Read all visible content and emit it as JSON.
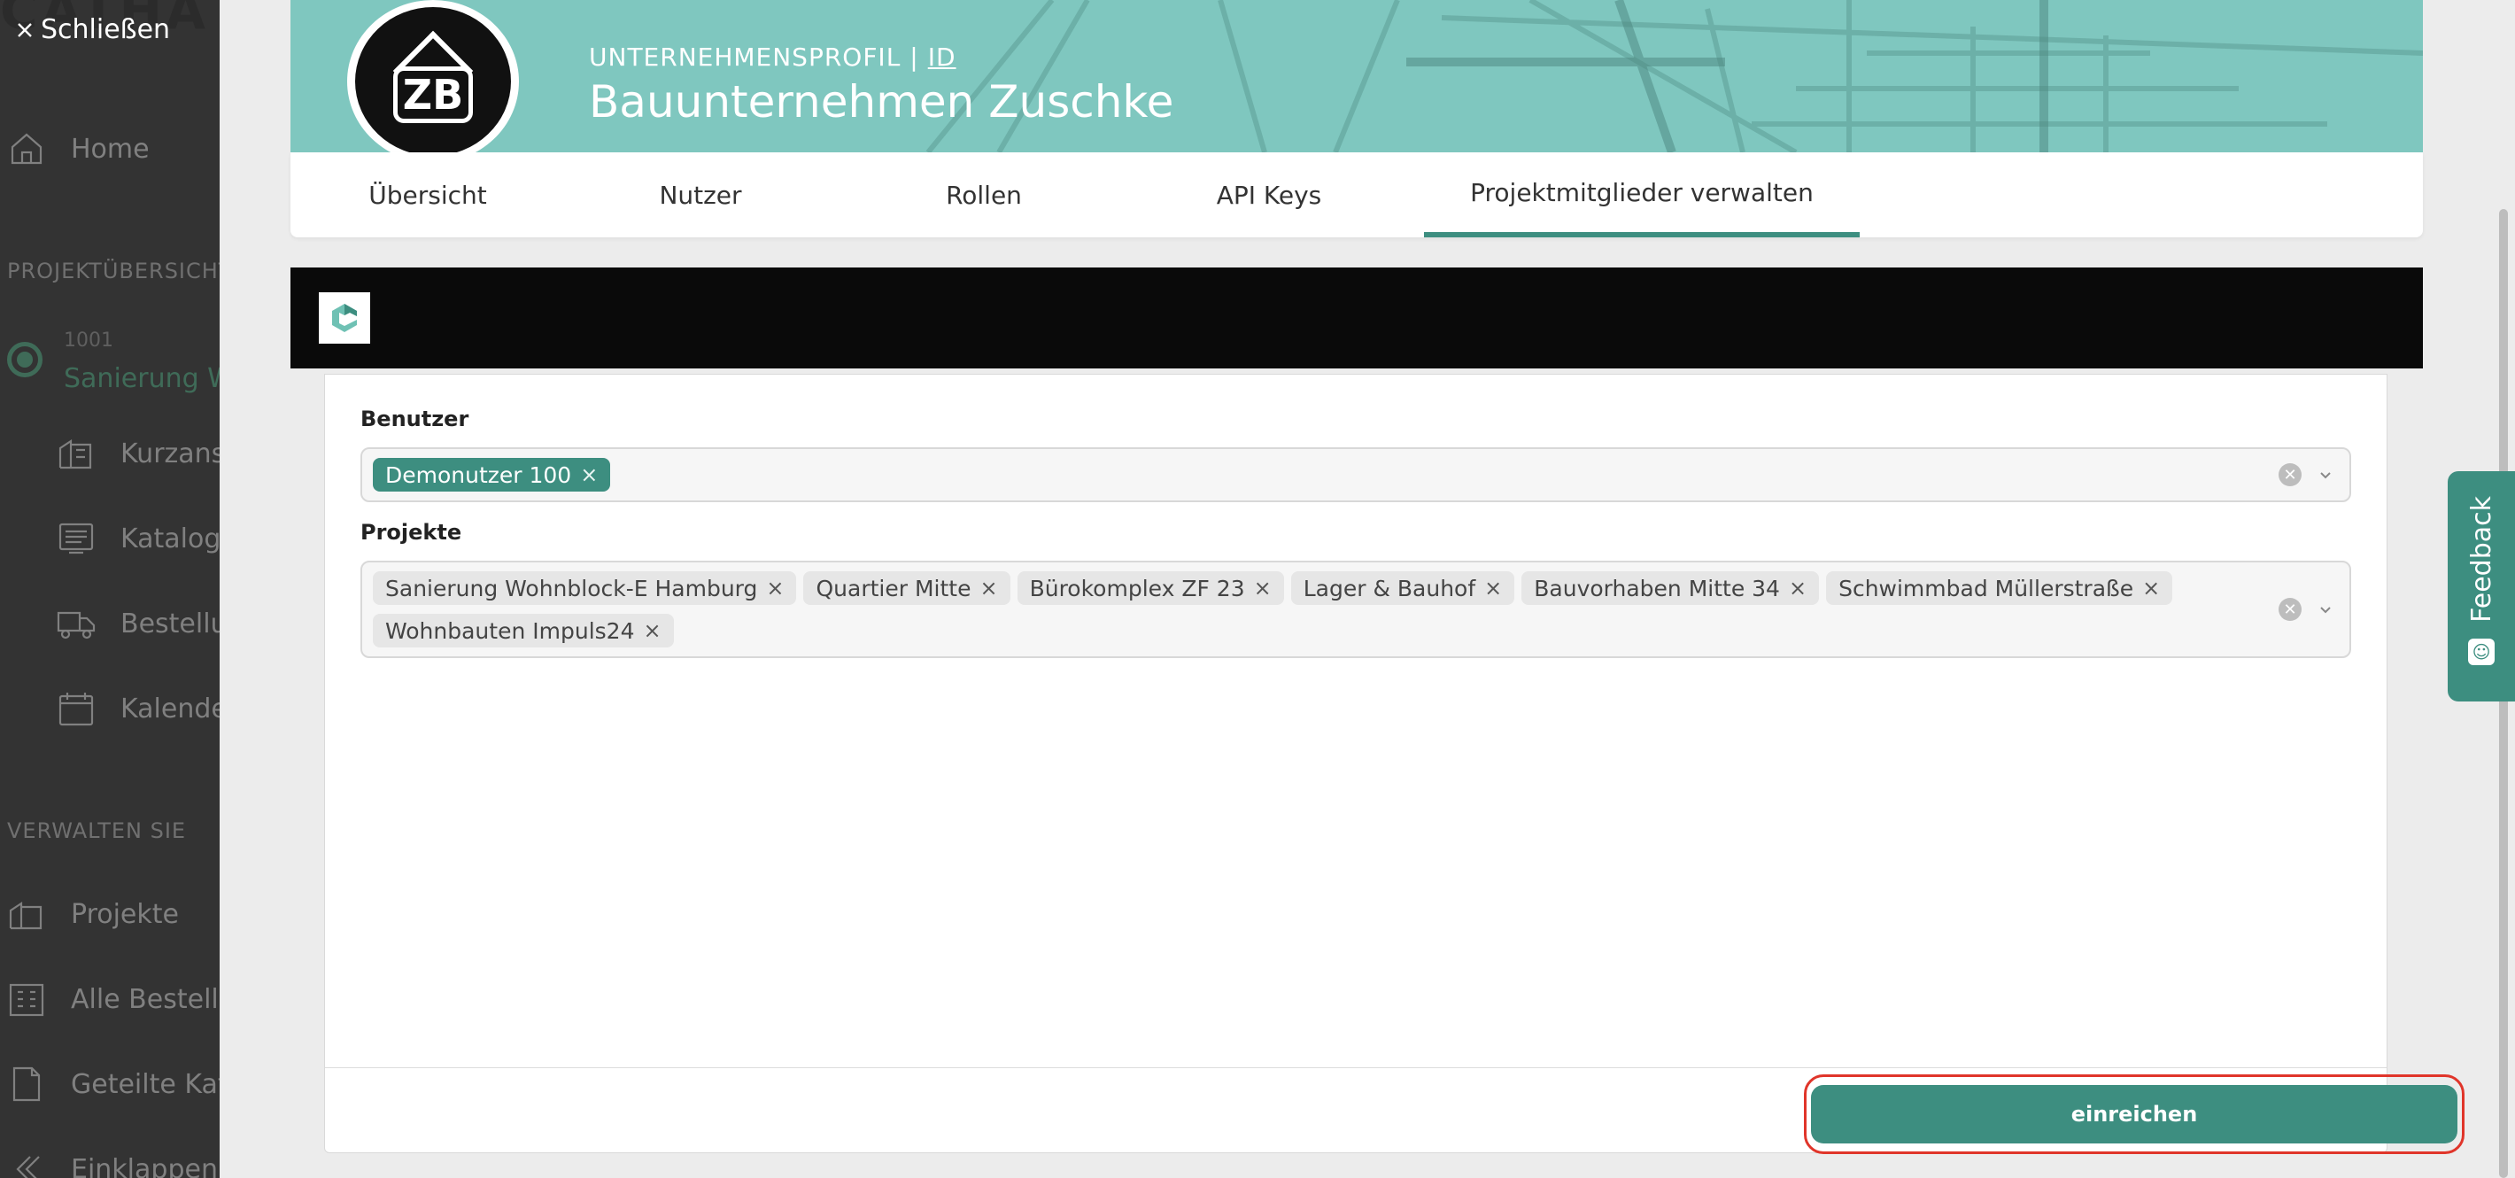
{
  "sidebar": {
    "close_label": "Schließen",
    "logo_fragment": "CATHA",
    "home": "Home",
    "section_projects": "PROJEKTÜBERSICHT",
    "project_number": "1001",
    "project_name": "Sanierung Wohnblock-E Hamburg",
    "items": [
      "Kurzansicht",
      "Katalog",
      "Bestellungen",
      "Kalender"
    ],
    "section_manage": "VERWALTEN SIE",
    "manage_items": [
      "Projekte",
      "Alle Bestellungen",
      "Geteilte Kataloge",
      "Einklappen"
    ]
  },
  "header": {
    "kicker": "UNTERNEHMENSPROFIL",
    "separator": "|",
    "id_link": "ID",
    "company_name": "Bauunternehmen Zuschke",
    "avatar_text": "ZB"
  },
  "tabs": [
    {
      "label": "Übersicht",
      "active": false
    },
    {
      "label": "Nutzer",
      "active": false
    },
    {
      "label": "Rollen",
      "active": false
    },
    {
      "label": "API Keys",
      "active": false
    },
    {
      "label": "Projektmitglieder verwalten",
      "active": true
    }
  ],
  "form": {
    "users_label": "Benutzer",
    "users_selected": [
      "Demonutzer 100"
    ],
    "projects_label": "Projekte",
    "projects_selected": [
      "Sanierung Wohnblock-E Hamburg",
      "Quartier Mitte",
      "Bürokomplex ZF 23",
      "Lager & Bauhof",
      "Bauvorhaben Mitte 34",
      "Schwimmbad Müllerstraße",
      "Wohnbauten Impuls24"
    ],
    "chip_remove_glyph": "×",
    "submit_label": "einreichen"
  },
  "feedback_label": "Feedback",
  "colors": {
    "accent": "#3d8e80",
    "header_bg": "#7fc7bf",
    "highlight": "#e0352a",
    "overlay": "#333333"
  }
}
